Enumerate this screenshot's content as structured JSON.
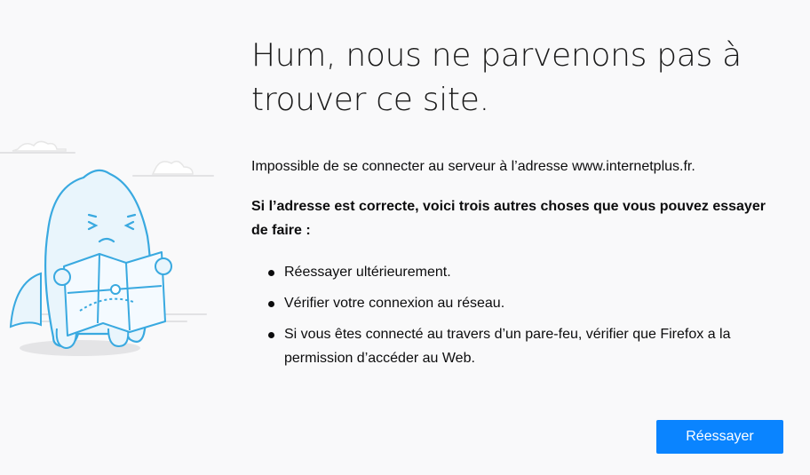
{
  "error": {
    "title": "Hum, nous ne parvenons pas à trouver ce site.",
    "description": "Impossible de se connecter au serveur à l’adresse www.internetplus.fr.",
    "advice_heading": "Si l’adresse est correcte, voici trois autres choses que vous pouvez essayer de faire :",
    "tips": [
      "Réessayer ultérieurement.",
      "Vérifier votre connexion au réseau.",
      "Si vous êtes connecté au travers d’un pare-feu, vérifier que Firefox a la permission d’accéder au Web."
    ]
  },
  "actions": {
    "retry_label": "Réessayer"
  },
  "illustration": {
    "icon": "lost-monster-with-map-icon"
  },
  "colors": {
    "background": "#f9f9fa",
    "accent": "#0a84ff",
    "illustration_stroke": "#39a9e0",
    "illustration_fill": "#e9f5fc"
  }
}
